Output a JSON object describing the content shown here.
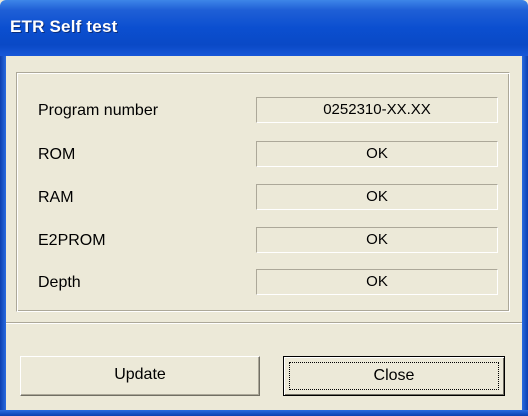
{
  "window": {
    "title": "ETR Self test"
  },
  "rows": [
    {
      "label": "Program number",
      "value": "0252310-XX.XX"
    },
    {
      "label": "ROM",
      "value": "OK"
    },
    {
      "label": "RAM",
      "value": "OK"
    },
    {
      "label": "E2PROM",
      "value": "OK"
    },
    {
      "label": "Depth",
      "value": "OK"
    }
  ],
  "buttons": {
    "update_label": "Update",
    "close_label": "Close"
  },
  "colors": {
    "titlebar": "#0b4fd0",
    "dialog_bg": "#ece9d8"
  }
}
